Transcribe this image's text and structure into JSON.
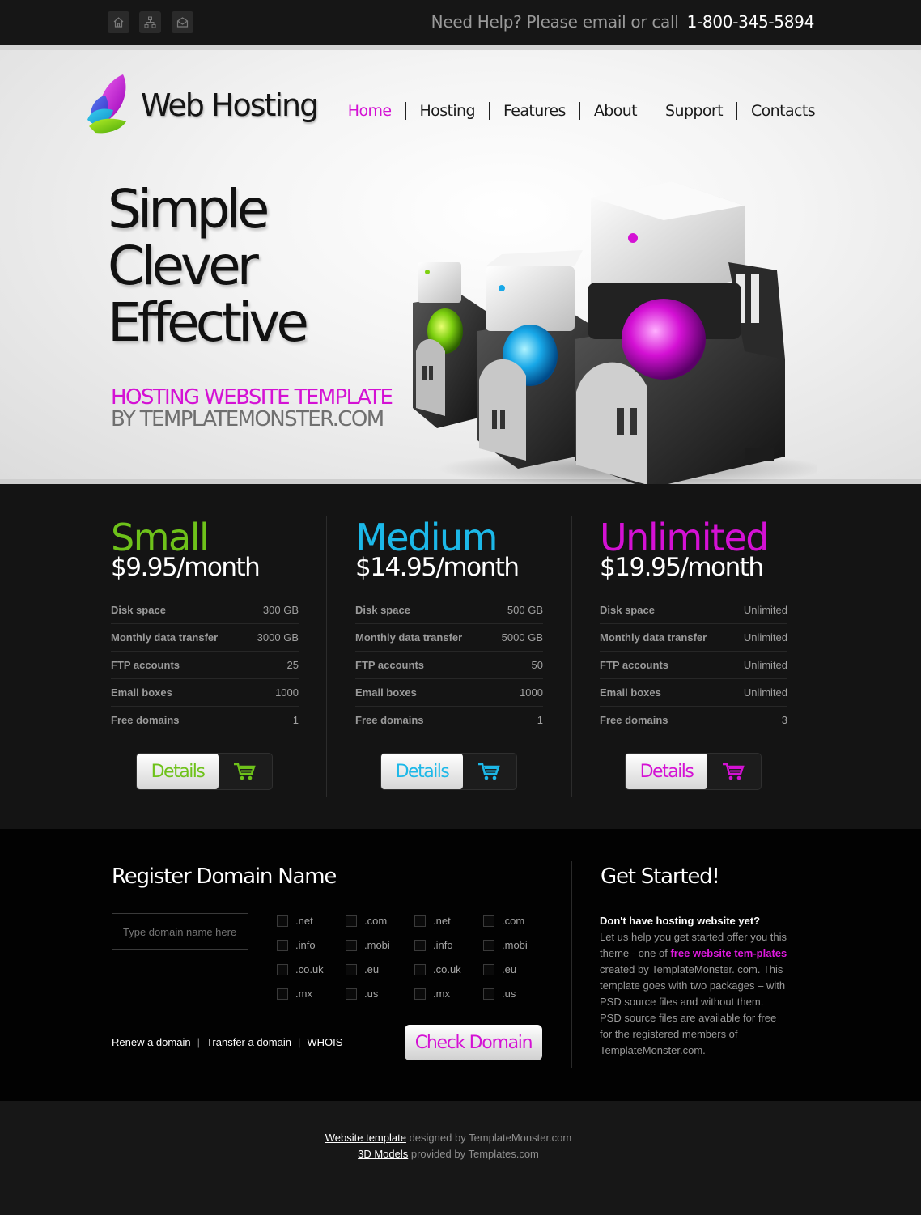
{
  "topbar": {
    "icons": [
      "home-icon",
      "sitemap-icon",
      "mail-icon"
    ],
    "help_text": "Need Help? Please email or call",
    "phone": "1-800-345-5894"
  },
  "header": {
    "logo_text": "Web Hosting",
    "nav": [
      "Home",
      "Hosting",
      "Features",
      "About",
      "Support",
      "Contacts"
    ],
    "active_nav": "Home"
  },
  "hero": {
    "headline": [
      "Simple",
      "Clever",
      "Effective"
    ],
    "tagline_1": "HOSTING WEBSITE TEMPLATE",
    "tagline_2": "BY TEMPLATEMONSTER.COM"
  },
  "plans": [
    {
      "name": "Small",
      "price": "$9.95/month",
      "color": "#6ec21a",
      "specs": [
        {
          "label": "Disk space",
          "value": "300 GB"
        },
        {
          "label": "Monthly data transfer",
          "value": "3000 GB"
        },
        {
          "label": "FTP accounts",
          "value": "25"
        },
        {
          "label": "Email boxes",
          "value": "1000"
        },
        {
          "label": "Free domains",
          "value": "1"
        }
      ],
      "button": "Details"
    },
    {
      "name": "Medium",
      "price": "$14.95/month",
      "color": "#1cb8e8",
      "specs": [
        {
          "label": "Disk space",
          "value": "500 GB"
        },
        {
          "label": "Monthly data transfer",
          "value": "5000 GB"
        },
        {
          "label": "FTP accounts",
          "value": "50"
        },
        {
          "label": "Email boxes",
          "value": "1000"
        },
        {
          "label": "Free domains",
          "value": "1"
        }
      ],
      "button": "Details"
    },
    {
      "name": "Unlimited",
      "price": "$19.95/month",
      "color": "#d411d4",
      "specs": [
        {
          "label": "Disk space",
          "value": "Unlimited"
        },
        {
          "label": "Monthly data transfer",
          "value": "Unlimited"
        },
        {
          "label": "FTP accounts",
          "value": "Unlimited"
        },
        {
          "label": "Email boxes",
          "value": "Unlimited"
        },
        {
          "label": "Free domains",
          "value": "3"
        }
      ],
      "button": "Details"
    }
  ],
  "domain": {
    "title": "Register Domain Name",
    "input_placeholder": "Type domain name here",
    "tlds": [
      [
        ".net",
        ".com",
        ".net",
        ".com"
      ],
      [
        ".info",
        ".mobi",
        ".info",
        ".mobi"
      ],
      [
        ".co.uk",
        ".eu",
        ".co.uk",
        ".eu"
      ],
      [
        ".mx",
        ".us",
        ".mx",
        ".us"
      ]
    ],
    "links": [
      "Renew a domain",
      "Transfer a domain",
      "WHOIS"
    ],
    "link_separator": "|",
    "check_button": "Check Domain"
  },
  "get_started": {
    "title": "Get Started!",
    "lead": "Don't have hosting website yet?",
    "text_before": "Let us help you get started offer you this theme - one of",
    "link": "free website tem-plates",
    "text_after": "created by TemplateMonster. com. This template goes with two packages – with PSD source files and without them. PSD source files are available for free for the registered members of TemplateMonster.com."
  },
  "footer": {
    "line1_link": "Website template",
    "line1_text": "designed by TemplateMonster.com",
    "line2_link": "3D Models",
    "line2_text": "provided by Templates.com"
  },
  "colors": {
    "accent": "#d411d4",
    "green": "#6ec21a",
    "blue": "#1cb8e8"
  }
}
